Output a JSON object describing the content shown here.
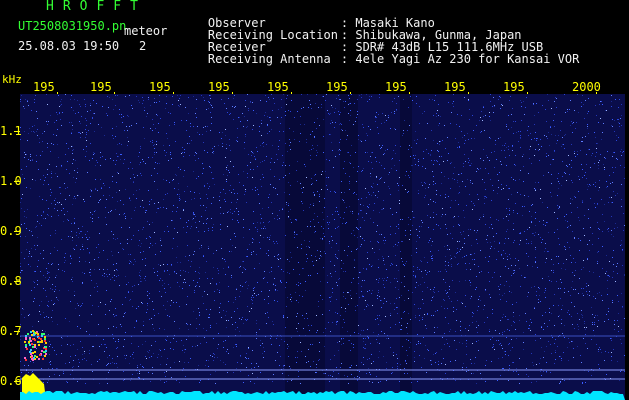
{
  "header": {
    "brand": "HROFFT",
    "filename": "UT2508031950.pn",
    "meteor_label": "meteor",
    "datetime": "25.08.03 19:50",
    "meteor_count": "2",
    "info": [
      {
        "key": "Observer",
        "sep": ": ",
        "value": "Masaki Kano"
      },
      {
        "key": "Receiving Location",
        "sep": ": ",
        "value": "Shibukawa, Gunma, Japan"
      },
      {
        "key": "Receiver",
        "sep": ": ",
        "value": "SDR# 43dB L15 111.6MHz USB"
      },
      {
        "key": "Receiving Antenna",
        "sep": ": ",
        "value": "4ele Yagi Az 230 for Kansai VOR"
      }
    ]
  },
  "x_axis": {
    "ticks": [
      "195",
      "195",
      "195",
      "195",
      "195",
      "195",
      "195",
      "195",
      "195",
      "2000"
    ]
  },
  "y_axis": {
    "unit": "kHz",
    "ticks": [
      "1.1",
      "1.0",
      "0.9",
      "0.8",
      "0.7",
      "0.6"
    ]
  },
  "colors": {
    "background": "#0a0d4a",
    "noise": "#3a5cff",
    "label": "#ffff00",
    "baseline": "#00e5ff"
  }
}
